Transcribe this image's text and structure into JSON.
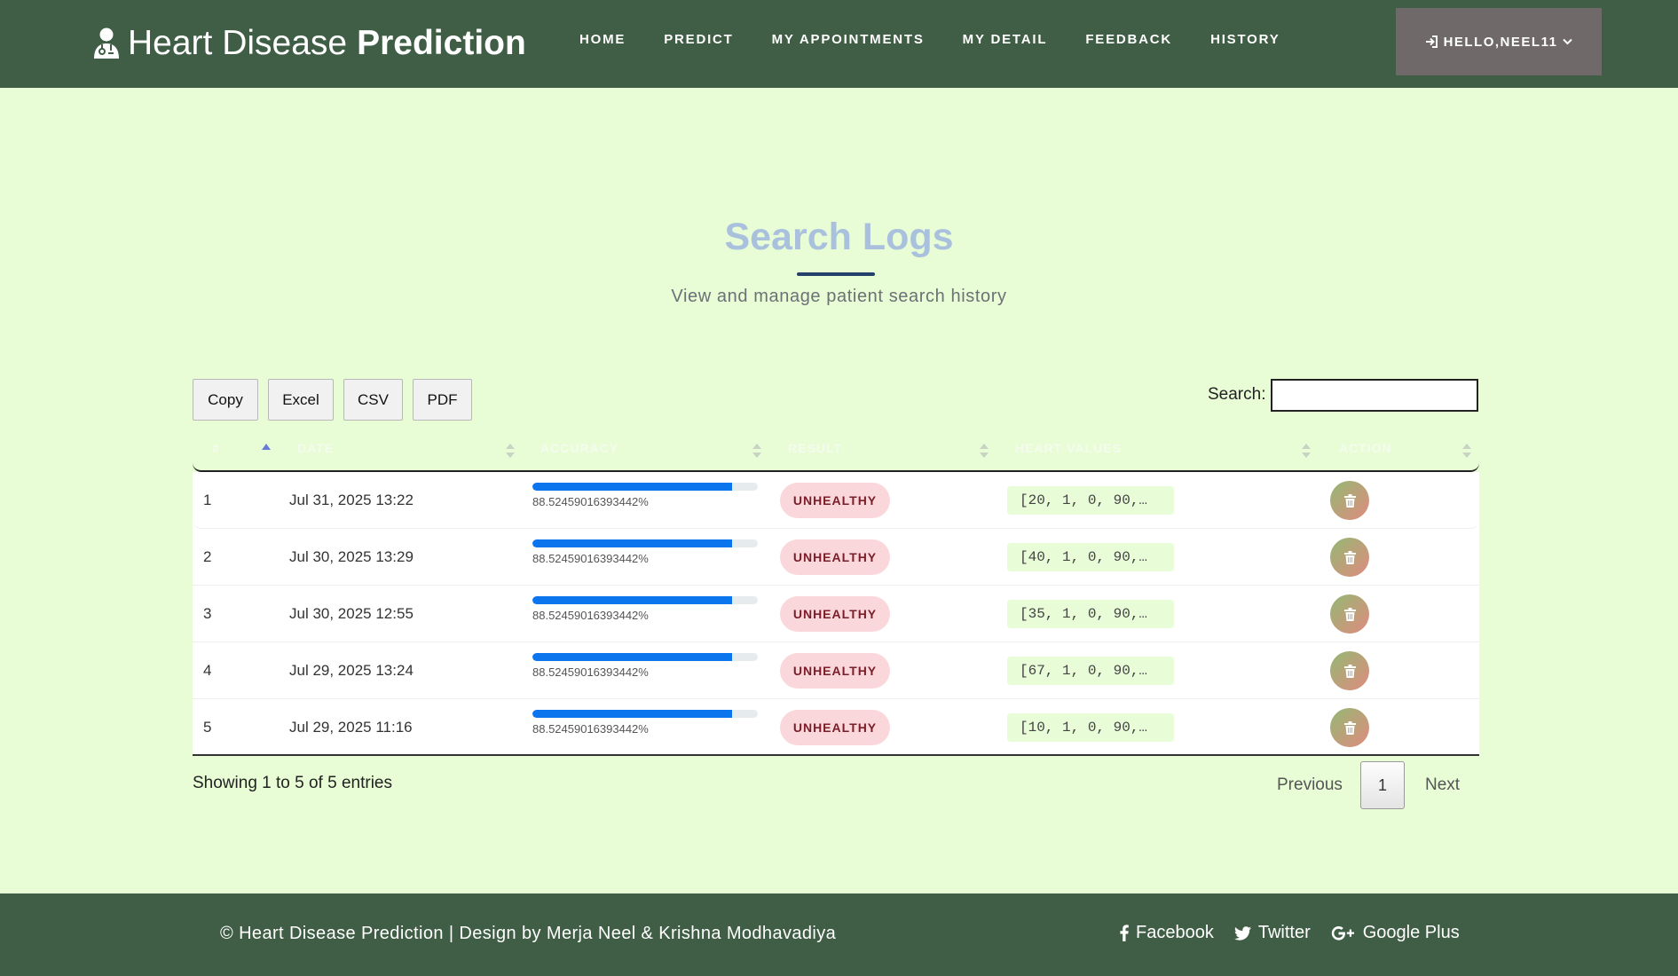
{
  "brand": {
    "part1": "Heart Disease",
    "part2": "Prediction"
  },
  "nav": {
    "items": [
      "HOME",
      "PREDICT",
      "MY APPOINTMENTS",
      "MY DETAIL",
      "FEEDBACK",
      "HISTORY"
    ],
    "user_label": "HELLO,NEEL11"
  },
  "heading": {
    "title": "Search Logs",
    "subtitle": "View and manage patient search history"
  },
  "toolbar": {
    "buttons": [
      "Copy",
      "Excel",
      "CSV",
      "PDF"
    ],
    "search_label": "Search:",
    "search_value": ""
  },
  "table": {
    "columns": [
      "#",
      "DATE",
      "ACCURACY",
      "RESULT",
      "HEART VALUES",
      "ACTION"
    ],
    "rows": [
      {
        "num": "1",
        "date": "Jul 31, 2025 13:22",
        "accuracy": "88.52459016393442%",
        "accuracy_value": 88.52459016393442,
        "result": "UNHEALTHY",
        "heart_values": "[20, 1, 0, 90,…"
      },
      {
        "num": "2",
        "date": "Jul 30, 2025 13:29",
        "accuracy": "88.52459016393442%",
        "accuracy_value": 88.52459016393442,
        "result": "UNHEALTHY",
        "heart_values": "[40, 1, 0, 90,…"
      },
      {
        "num": "3",
        "date": "Jul 30, 2025 12:55",
        "accuracy": "88.52459016393442%",
        "accuracy_value": 88.52459016393442,
        "result": "UNHEALTHY",
        "heart_values": "[35, 1, 0, 90,…"
      },
      {
        "num": "4",
        "date": "Jul 29, 2025 13:24",
        "accuracy": "88.52459016393442%",
        "accuracy_value": 88.52459016393442,
        "result": "UNHEALTHY",
        "heart_values": "[67, 1, 0, 90,…"
      },
      {
        "num": "5",
        "date": "Jul 29, 2025 11:16",
        "accuracy": "88.52459016393442%",
        "accuracy_value": 88.52459016393442,
        "result": "UNHEALTHY",
        "heart_values": "[10, 1, 0, 90,…"
      }
    ]
  },
  "pagination": {
    "info": "Showing 1 to 5 of 5 entries",
    "previous": "Previous",
    "current_page": "1",
    "next": "Next"
  },
  "footer": {
    "copyright": "© Heart Disease Prediction | Design by Merja Neel & Krishna Modhavadiya",
    "social": [
      "Facebook",
      "Twitter",
      "Google Plus"
    ]
  },
  "colors": {
    "navbar": "#3f5e45",
    "page_bg": "#e8fdd6",
    "accent_blue": "#0a75ec",
    "badge_bg": "#f9d7da",
    "badge_text": "#7b1d28"
  }
}
